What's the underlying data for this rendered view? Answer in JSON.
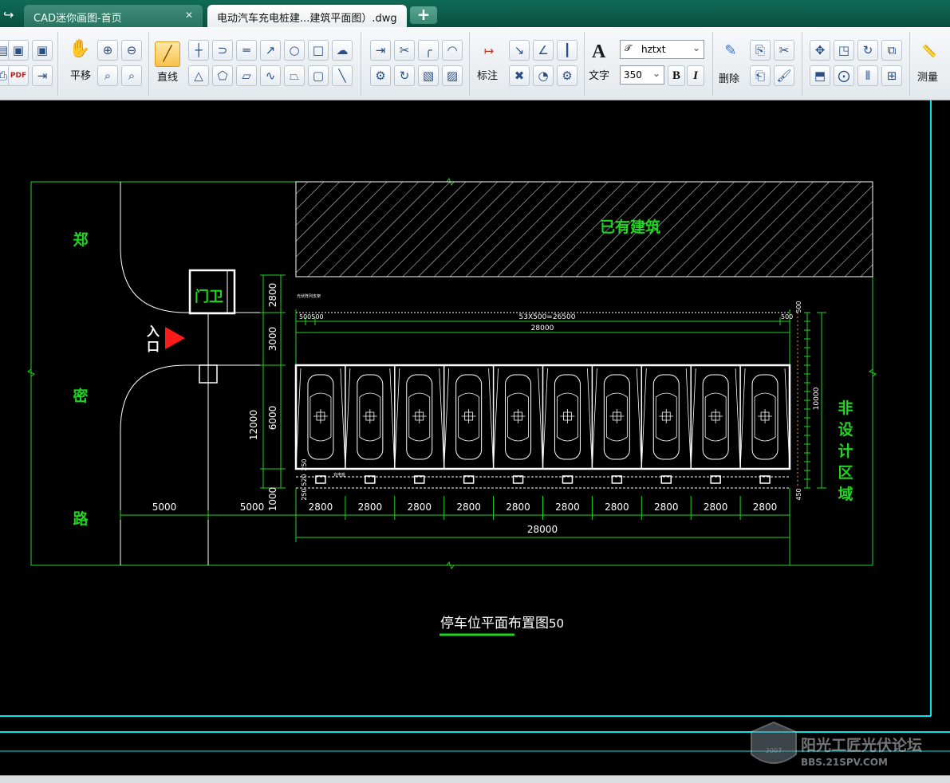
{
  "tabs": [
    {
      "label": "CAD迷你画图-首页"
    },
    {
      "label": "电动汽车充电桩建...建筑平面图）.dwg"
    }
  ],
  "ribbon": {
    "pan_label": "平移",
    "line_label": "直线",
    "dimension_label": "标注",
    "text_label": "文字",
    "font_value": "hztxt",
    "size_value": "350",
    "bold_label": "B",
    "italic_label": "I",
    "delete_label": "删除",
    "measure_label": "测量"
  },
  "drawing": {
    "road_chars": [
      "郑",
      "密",
      "路"
    ],
    "existing_building": "已有建筑",
    "guard_house": "门卫",
    "entrance_chars": [
      "入",
      "口"
    ],
    "non_design_chars": [
      "非",
      "设",
      "计",
      "区",
      "域"
    ],
    "title": "停车位平面布置图",
    "scale": "50",
    "top_dim_small": "53X500=26500",
    "top_dim_left": "500500",
    "top_dim_right": "500",
    "top_dim_total": "28000",
    "dim_12000": "12000",
    "dim_2800_v": "2800",
    "dim_3000_v": "3000",
    "dim_6000_v": "6000",
    "dim_1000_v": "1000",
    "dim_250_a": "250",
    "dim_520": "520",
    "dim_250_b": "250",
    "dim_5000_a": "5000",
    "dim_5000_b": "5000",
    "bay_width": "2800",
    "bottom_total": "28000",
    "right_total": "10000",
    "right_500_top": "500",
    "right_450": "450",
    "small_label_top": "光伏阵列支架",
    "small_label_bottom": "充电桩",
    "watermark_main": "阳光工匠光伏论坛",
    "watermark_url": "BBS.21SPV.COM",
    "watermark_year": "2007",
    "parking_bay_count": 10
  }
}
